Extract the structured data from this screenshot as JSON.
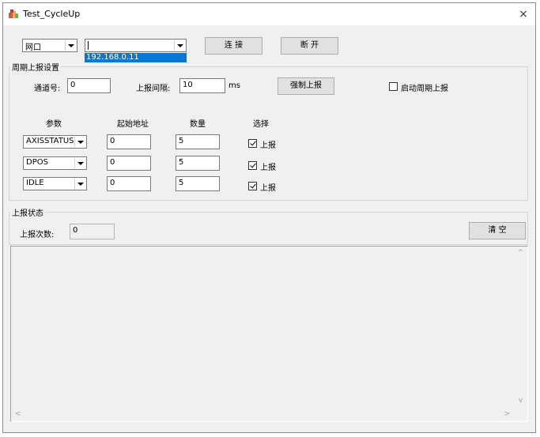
{
  "window": {
    "title": "Test_CycleUp",
    "close_label": "×"
  },
  "connection": {
    "type_value": "网口",
    "ip_value": "",
    "ip_dropdown_item": "192.168.0.11",
    "connect_label": "连 接",
    "disconnect_label": "断 开"
  },
  "cycle_group": {
    "title": "周期上报设置",
    "channel_label": "通道号:",
    "channel_value": "0",
    "interval_label": "上报间隔:",
    "interval_value": "10",
    "interval_unit": "ms",
    "force_label": "强制上报",
    "enable_label": "启动周期上报",
    "headers": {
      "param": "参数",
      "addr": "起始地址",
      "count": "数量",
      "select": "选择"
    },
    "rows": [
      {
        "param": "AXISSTATUS",
        "addr": "0",
        "count": "5",
        "select_label": "上报",
        "checked": true
      },
      {
        "param": "DPOS",
        "addr": "0",
        "count": "5",
        "select_label": "上报",
        "checked": true
      },
      {
        "param": "IDLE",
        "addr": "0",
        "count": "5",
        "select_label": "上报",
        "checked": true
      }
    ]
  },
  "status_group": {
    "title": "上报状态",
    "count_label": "上报次数:",
    "count_value": "0",
    "clear_label": "清 空"
  },
  "scroll": {
    "up": "^",
    "down": "v",
    "left": "<",
    "right": ">"
  }
}
